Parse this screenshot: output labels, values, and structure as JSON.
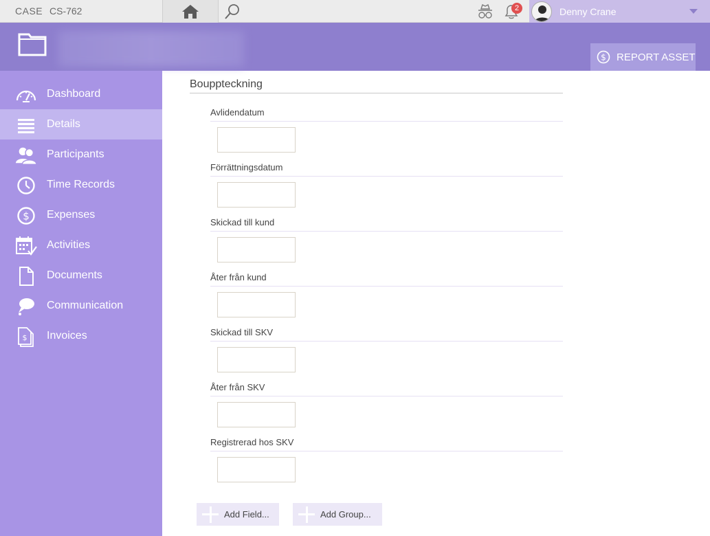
{
  "topbar": {
    "case_label": "CASE",
    "case_id": "CS-762",
    "notification_count": "2",
    "user_name": "Denny Crane",
    "icons": [
      "home-icon",
      "search-icon",
      "spy-icon",
      "bell-icon",
      "avatar"
    ]
  },
  "header": {
    "report_button_label": "REPORT ASSET"
  },
  "sidebar": {
    "items": [
      {
        "label": "Dashboard",
        "icon": "dashboard-icon"
      },
      {
        "label": "Details",
        "icon": "list-icon",
        "active": true
      },
      {
        "label": "Participants",
        "icon": "people-icon"
      },
      {
        "label": "Time Records",
        "icon": "clock-icon"
      },
      {
        "label": "Expenses",
        "icon": "dollar-icon"
      },
      {
        "label": "Activities",
        "icon": "calendar-icon"
      },
      {
        "label": "Documents",
        "icon": "document-icon"
      },
      {
        "label": "Communication",
        "icon": "chat-icon"
      },
      {
        "label": "Invoices",
        "icon": "invoice-icon"
      }
    ]
  },
  "main": {
    "section_title": "Bouppteckning",
    "fields": [
      {
        "label": "Avlidendatum",
        "value": ""
      },
      {
        "label": "Förrättningsdatum",
        "value": ""
      },
      {
        "label": "Skickad till kund",
        "value": ""
      },
      {
        "label": "Åter från kund",
        "value": ""
      },
      {
        "label": "Skickad till SKV",
        "value": ""
      },
      {
        "label": "Åter från SKV",
        "value": ""
      },
      {
        "label": "Registrerad hos SKV",
        "value": ""
      }
    ],
    "add_field_label": "Add Field...",
    "add_group_label": "Add Group..."
  },
  "colors": {
    "sidebar": "#a894e5",
    "sidebar_active": "#c2b6ef",
    "header": "#8e7fce",
    "accent_button": "#a99edf"
  }
}
